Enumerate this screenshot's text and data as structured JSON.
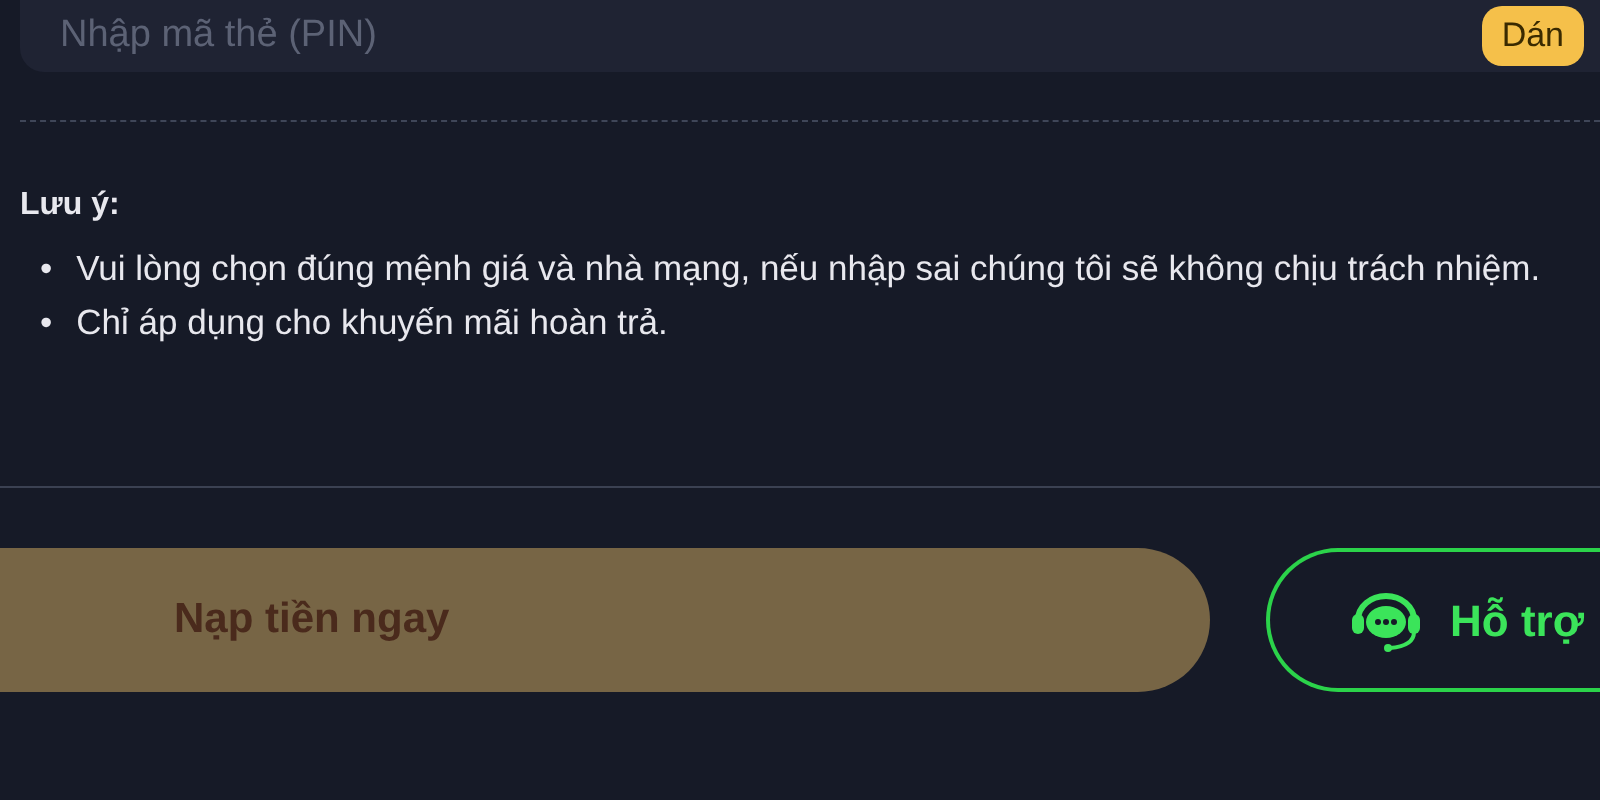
{
  "pin_field": {
    "placeholder": "Nhập mã thẻ (PIN)",
    "paste_button": "Dán"
  },
  "note": {
    "title": "Lưu ý:",
    "items": [
      {
        "bullet": "•",
        "text": "Vui lòng chọn đúng mệnh giá và nhà mạng, nếu nhập sai chúng tôi sẽ không chịu trách nhiệm."
      },
      {
        "bullet": "•",
        "text": "Chỉ áp dụng cho khuyến mãi hoàn trả."
      }
    ]
  },
  "buttons": {
    "deposit": {
      "label": "Nạp tiền ngay",
      "disabled": true
    },
    "support": {
      "label": "Hỗ trợ"
    }
  }
}
